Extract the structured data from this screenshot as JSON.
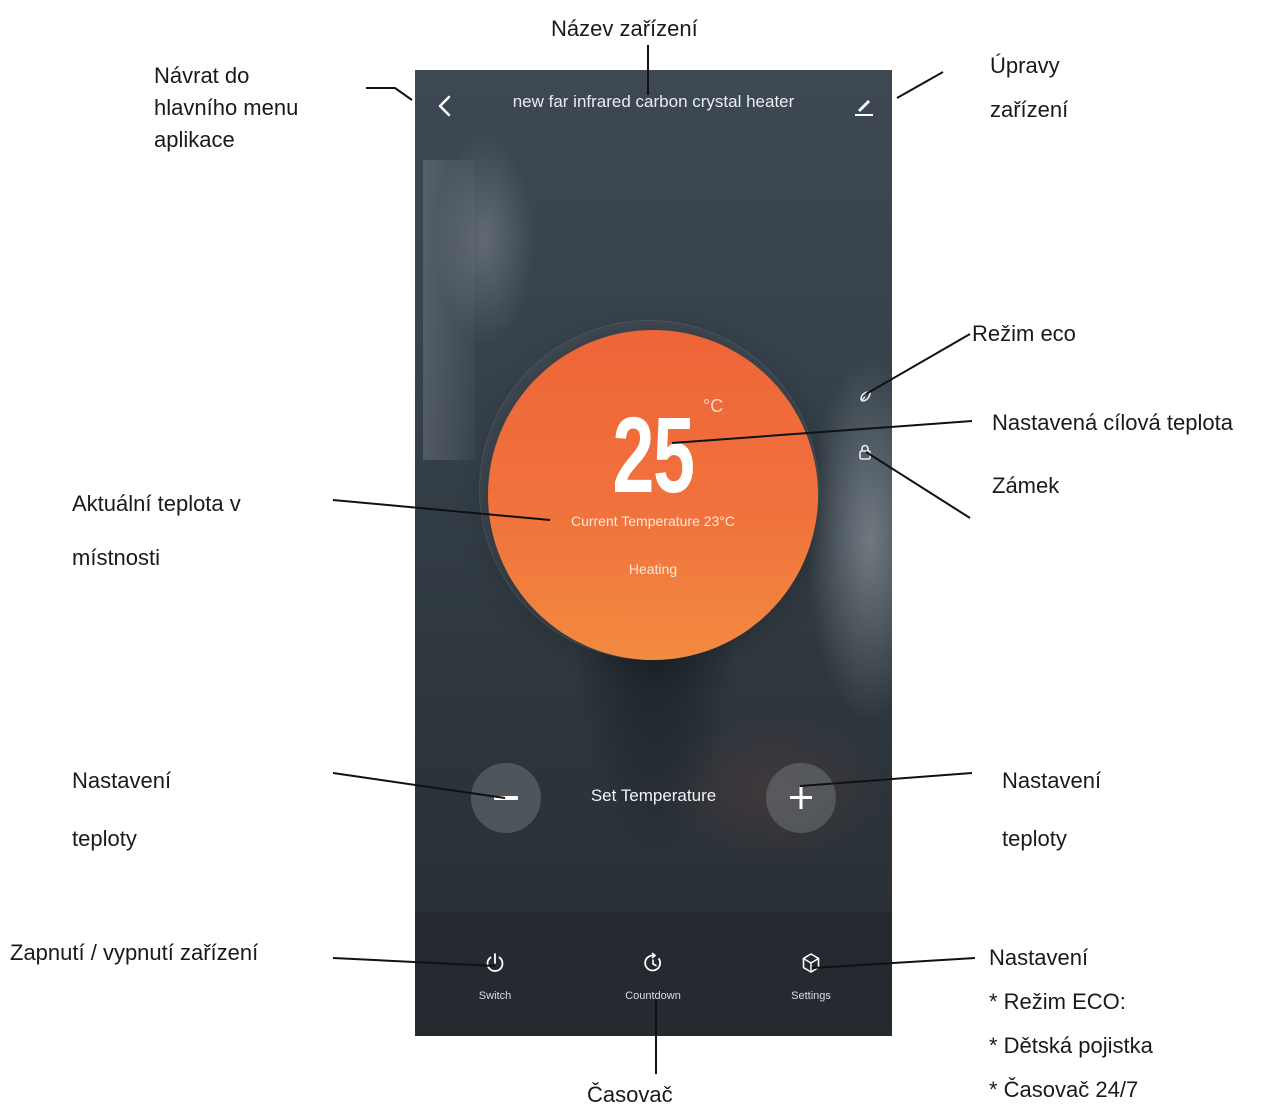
{
  "annotations": {
    "device_name": "Název zařízení",
    "back_lines": [
      "Návrat do",
      "hlavního menu",
      "aplikace"
    ],
    "edit_lines": [
      "Úpravy",
      "zařízení"
    ],
    "eco": "Režim eco",
    "target_temp": "Nastavená cílová teplota",
    "lock": "Zámek",
    "current_temp_lines": [
      "Aktuální teplota v",
      "místnosti"
    ],
    "set_temp_left_lines": [
      "Nastavení",
      "teploty"
    ],
    "set_temp_right_lines": [
      "Nastavení",
      "teploty"
    ],
    "power": "Zapnutí / vypnutí zařízení",
    "settings_lines": [
      "Nastavení",
      "* Režim ECO:",
      "* Dětská pojistka",
      "* Časovač 24/7"
    ],
    "timer": "Časovač"
  },
  "app": {
    "title": "new far infrared carbon crystal heater",
    "target_temperature": "25",
    "unit": "°C",
    "current_temperature": "Current Temperature 23°C",
    "status": "Heating",
    "set_temperature_label": "Set Temperature",
    "bottom": {
      "switch": "Switch",
      "countdown": "Countdown",
      "settings": "Settings"
    }
  },
  "icons": [
    "back-icon",
    "edit-icon",
    "eco-icon",
    "lock-icon",
    "minus-icon",
    "plus-icon",
    "power-icon",
    "countdown-icon",
    "settings-icon"
  ],
  "colors": {
    "dial": "#ef6a3a",
    "background": "#333d46"
  }
}
